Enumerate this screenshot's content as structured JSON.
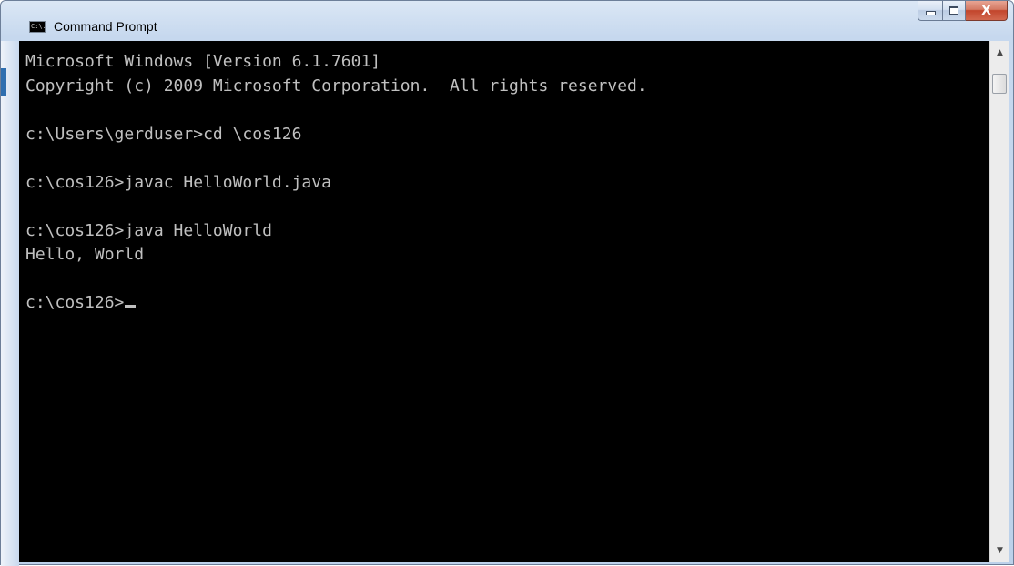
{
  "window": {
    "title": "Command Prompt",
    "icon": "cmd-icon",
    "icon_text": "C:\\."
  },
  "caption_buttons": {
    "minimize": "minimize-icon",
    "maximize": "maximize-icon",
    "close": "close-icon",
    "close_glyph": "X"
  },
  "console": {
    "lines": [
      "Microsoft Windows [Version 6.1.7601]",
      "Copyright (c) 2009 Microsoft Corporation.  All rights reserved.",
      "",
      "c:\\Users\\gerduser>cd \\cos126",
      "",
      "c:\\cos126>javac HelloWorld.java",
      "",
      "c:\\cos126>java HelloWorld",
      "Hello, World",
      "",
      "c:\\cos126>"
    ],
    "text_color": "#c0c0c0",
    "background_color": "#000000"
  },
  "scrollbar": {
    "up_icon": "scroll-up-arrow-icon",
    "down_icon": "scroll-down-arrow-icon",
    "up_glyph": "▲",
    "down_glyph": "▼"
  }
}
